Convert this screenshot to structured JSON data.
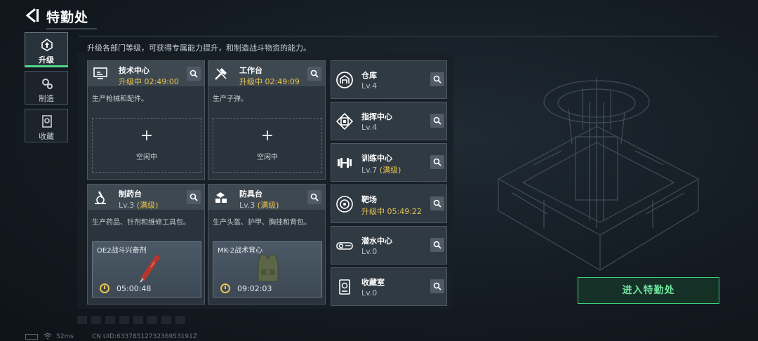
{
  "header": {
    "title": "特勤处",
    "hint": "升级各部门等级，可获得专属能力提升，和制造战斗物资的能力。"
  },
  "nav": [
    {
      "label": "升级",
      "icon": "upgrade-icon",
      "active": true
    },
    {
      "label": "制造",
      "icon": "gears-icon",
      "active": false
    },
    {
      "label": "收藏",
      "icon": "collection-icon",
      "active": false
    }
  ],
  "cards": {
    "tech": {
      "name": "技术中心",
      "status": "升级中 02:49:00",
      "desc": "生产枪械和配件。",
      "slot_plus": "+",
      "slot_label": "空闲中"
    },
    "workbench": {
      "name": "工作台",
      "status": "升级中 02:49:09",
      "desc": "生产子弹。",
      "slot_plus": "+",
      "slot_label": "空闲中"
    },
    "pharmacy": {
      "name": "制药台",
      "level": "Lv.3",
      "max": "(满级)",
      "desc": "生产药品、针剂和维修工具包。",
      "item_name": "OE2战斗兴奋剂",
      "item_time": "05:00:48"
    },
    "armor": {
      "name": "防具台",
      "level": "Lv.3",
      "max": "(满级)",
      "desc": "生产头盔、护甲、胸挂和背包。",
      "item_name": "MK-2战术背心",
      "item_time": "09:02:03"
    }
  },
  "right": [
    {
      "name": "仓库",
      "level": "Lv.4",
      "max": "",
      "icon": "warehouse-icon"
    },
    {
      "name": "指挥中心",
      "level": "Lv.4",
      "max": "",
      "icon": "chip-icon"
    },
    {
      "name": "训练中心",
      "level": "Lv.7",
      "max": "(满级)",
      "icon": "dumbbell-icon"
    },
    {
      "name": "靶场",
      "level": "升级中 05:49:22",
      "max": "",
      "icon": "target-icon",
      "upgrading": true
    },
    {
      "name": "潜水中心",
      "level": "Lv.0",
      "max": "",
      "icon": "goggles-icon"
    },
    {
      "name": "收藏室",
      "level": "Lv.0",
      "max": "",
      "icon": "display-case-icon"
    }
  ],
  "enter_button": "进入特勤处",
  "footer": {
    "ping": "52ms",
    "uid": "CN UID:6337851273236953191Z"
  },
  "colors": {
    "accent_green": "#4fd98a",
    "upgrade_yellow": "#e8c34f"
  }
}
